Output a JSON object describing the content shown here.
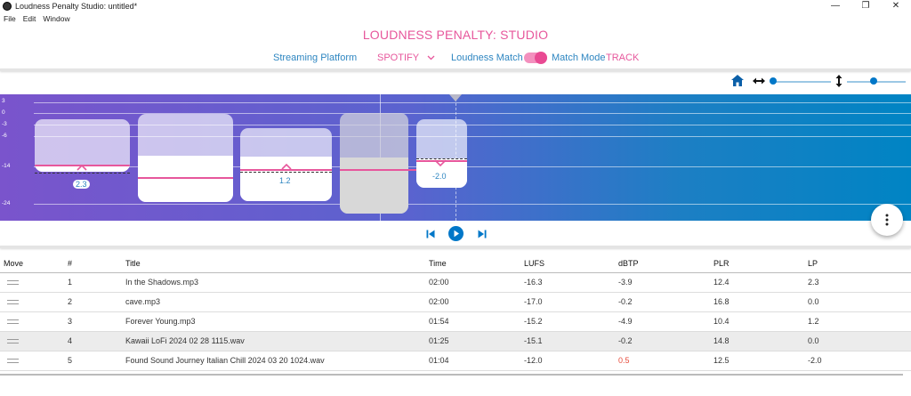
{
  "window": {
    "title": "Loudness Penalty Studio: untitled*",
    "controls": [
      "—",
      "❐",
      "✕"
    ]
  },
  "menu": [
    "File",
    "Edit",
    "Window"
  ],
  "header": {
    "app_title": "LOUDNESS PENALTY: STUDIO",
    "platform_label": "Streaming Platform",
    "platform_value": "SPOTIFY",
    "loudness_match_label": "Loudness Match",
    "match_mode_label": "Match Mode",
    "match_mode_value": "TRACK"
  },
  "viz": {
    "y_ticks": [
      "3",
      "0",
      "-3",
      "-6",
      "-14",
      "-24"
    ],
    "tracks": [
      {
        "lp_label": "2.3"
      },
      {
        "lp_label": ""
      },
      {
        "lp_label": "1.2"
      },
      {
        "lp_label": ""
      },
      {
        "lp_label": "-2.0"
      }
    ]
  },
  "colors": {
    "accent_pink": "#e7579c",
    "accent_blue": "#2e86c1",
    "transport_blue": "#0077c8",
    "warning_red": "#e74c3c"
  },
  "table": {
    "headers": [
      "Move",
      "#",
      "Title",
      "Time",
      "LUFS",
      "dBTP",
      "PLR",
      "LP"
    ],
    "rows": [
      {
        "num": "1",
        "title": "In the Shadows.mp3",
        "time": "02:00",
        "lufs": "-16.3",
        "dbtp": "-3.9",
        "plr": "12.4",
        "lp": "2.3"
      },
      {
        "num": "2",
        "title": "cave.mp3",
        "time": "02:00",
        "lufs": "-17.0",
        "dbtp": "-0.2",
        "plr": "16.8",
        "lp": "0.0"
      },
      {
        "num": "3",
        "title": "Forever Young.mp3",
        "time": "01:54",
        "lufs": "-15.2",
        "dbtp": "-4.9",
        "plr": "10.4",
        "lp": "1.2"
      },
      {
        "num": "4",
        "title": "Kawaii LoFi 2024 02 28 1115.wav",
        "time": "01:25",
        "lufs": "-15.1",
        "dbtp": "-0.2",
        "plr": "14.8",
        "lp": "0.0"
      },
      {
        "num": "5",
        "title": "Found Sound Journey Italian Chill 2024 03 20 1024.wav",
        "time": "01:04",
        "lufs": "-12.0",
        "dbtp": "0.5",
        "plr": "12.5",
        "lp": "-2.0"
      }
    ]
  }
}
